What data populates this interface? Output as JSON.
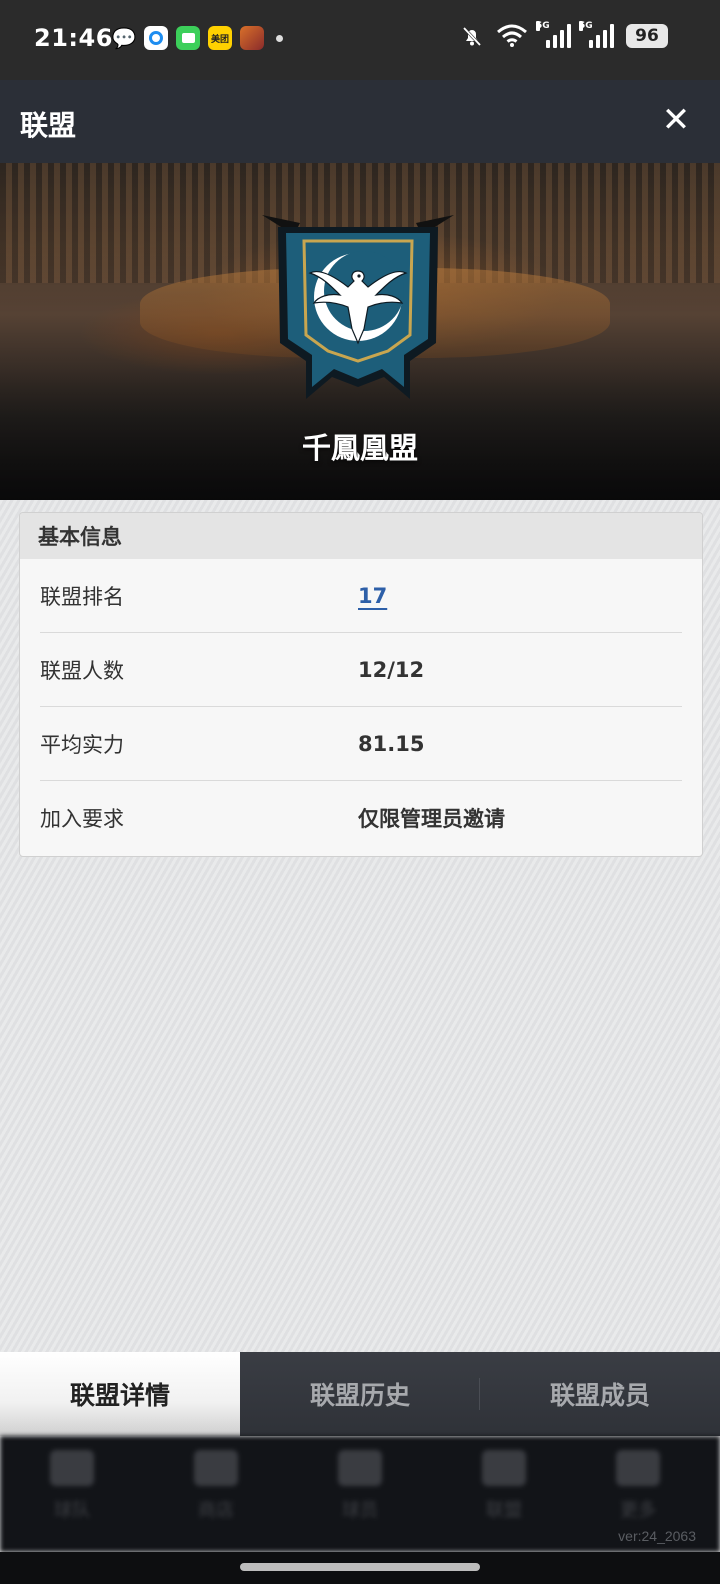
{
  "status_bar": {
    "time": "21:46",
    "app_icons": [
      "wechat-icon",
      "browser-icon",
      "messages-icon",
      "meituan-icon",
      "game-icon"
    ],
    "meituan_label": "美团",
    "network_1": "5G",
    "network_2": "5G",
    "battery": "96"
  },
  "header": {
    "title": "联盟",
    "close_icon": "close-icon"
  },
  "banner": {
    "alliance_name": "千鳳凰盟",
    "emblem": "phoenix-emblem"
  },
  "basic_info": {
    "heading": "基本信息",
    "rows": [
      {
        "label": "联盟排名",
        "value": "17"
      },
      {
        "label": "联盟人数",
        "value": "12/12"
      },
      {
        "label": "平均实力",
        "value": "81.15"
      },
      {
        "label": "加入要求",
        "value": "仅限管理员邀请"
      }
    ]
  },
  "tabs": [
    {
      "label": "联盟详情",
      "active": true
    },
    {
      "label": "联盟历史",
      "active": false
    },
    {
      "label": "联盟成员",
      "active": false
    }
  ],
  "bottom_nav": {
    "items": [
      "球队",
      "商店",
      "球员",
      "联盟",
      "更多"
    ]
  },
  "version": "ver:24_2063",
  "colors": {
    "titlebar": "#2b2f37",
    "link": "#2d5fa8",
    "emblem_blue": "#1d5e7a",
    "emblem_gold": "#c8a650"
  }
}
